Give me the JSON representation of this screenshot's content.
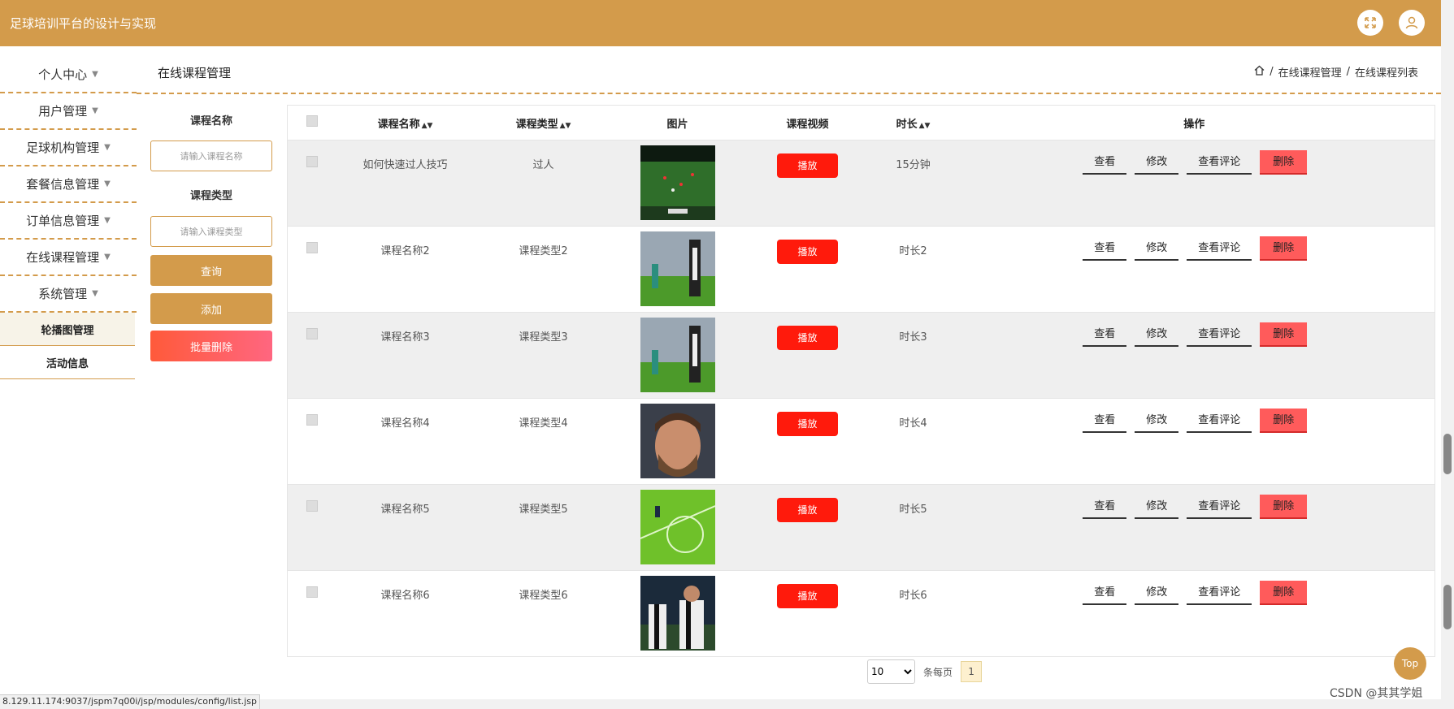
{
  "app": {
    "title": "足球培训平台的设计与实现"
  },
  "sidebar": {
    "items": [
      {
        "label": "个人中心"
      },
      {
        "label": "用户管理"
      },
      {
        "label": "足球机构管理"
      },
      {
        "label": "套餐信息管理"
      },
      {
        "label": "订单信息管理"
      },
      {
        "label": "在线课程管理"
      },
      {
        "label": "系统管理"
      }
    ],
    "subitems": [
      {
        "label": "轮播图管理"
      },
      {
        "label": "活动信息"
      }
    ]
  },
  "page": {
    "title": "在线课程管理",
    "breadcrumb": [
      "在线课程管理",
      "在线课程列表"
    ]
  },
  "search": {
    "name_label": "课程名称",
    "name_placeholder": "请输入课程名称",
    "type_label": "课程类型",
    "type_placeholder": "请输入课程类型",
    "query_btn": "查询",
    "add_btn": "添加",
    "batch_delete_btn": "批量删除"
  },
  "table": {
    "headers": [
      "课程名称",
      "课程类型",
      "图片",
      "课程视频",
      "时长",
      "操作"
    ],
    "play_label": "播放",
    "ops": [
      "查看",
      "修改",
      "查看评论",
      "删除"
    ],
    "rows": [
      {
        "name": "如何快速过人技巧",
        "type": "过人",
        "duration": "15分钟"
      },
      {
        "name": "课程名称2",
        "type": "课程类型2",
        "duration": "时长2"
      },
      {
        "name": "课程名称3",
        "type": "课程类型3",
        "duration": "时长3"
      },
      {
        "name": "课程名称4",
        "type": "课程类型4",
        "duration": "时长4"
      },
      {
        "name": "课程名称5",
        "type": "课程类型5",
        "duration": "时长5"
      },
      {
        "name": "课程名称6",
        "type": "课程类型6",
        "duration": "时长6"
      }
    ]
  },
  "pagination": {
    "page_size": "10",
    "per_page_label": "条每页",
    "current_page": "1"
  },
  "top_button": "Top",
  "status_url": "8.129.11.174:9037/jspm7q00i/jsp/modules/config/list.jsp",
  "watermark": "CSDN @其其学姐",
  "colors": {
    "accent": "#d39b4b",
    "play": "#ff1a0c",
    "delete": "#ff5b5b"
  }
}
